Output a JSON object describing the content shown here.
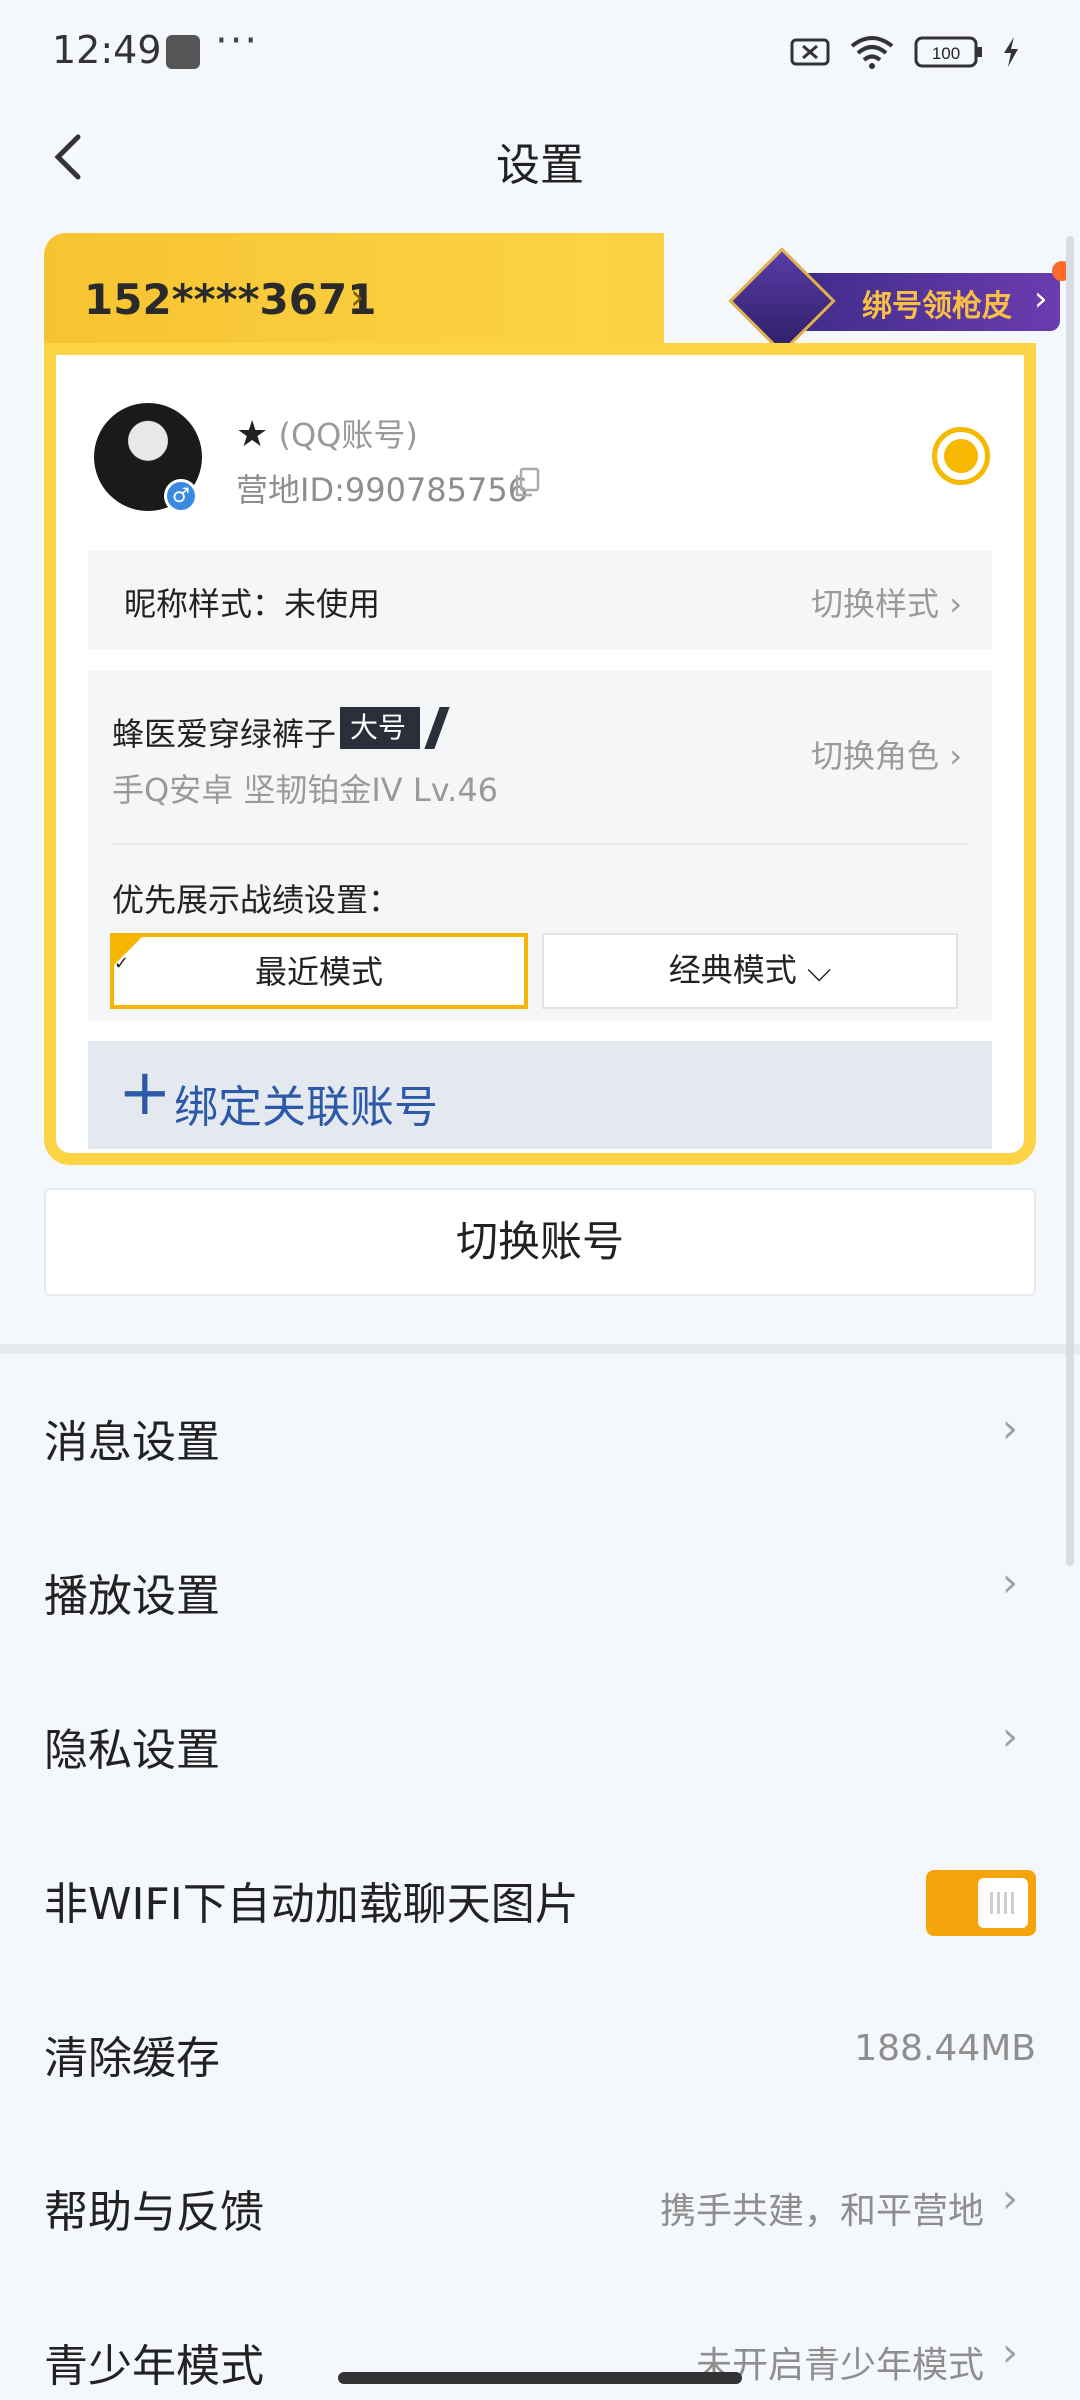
{
  "status_bar": {
    "time": "12:49",
    "dots": "···",
    "battery": "100"
  },
  "header": {
    "title": "设置"
  },
  "account_card": {
    "phone": "152****3671",
    "phone_arrow": "›",
    "promo": {
      "text": "绑号领枪皮",
      "arrow": "›"
    },
    "user": {
      "star": "★",
      "account_type": "(QQ账号)",
      "camp_id": "营地ID:990785756",
      "gender_symbol": "♂"
    },
    "nickname_style": {
      "label": "昵称样式：未使用",
      "action": "切换样式 ›"
    },
    "role": {
      "name": "蜂医爱穿绿裤子",
      "tag": "大号",
      "info": "手Q安卓  坚韧铂金IV  Lv.46",
      "switch": "切换角色 ›"
    },
    "pref_label": "优先展示战绩设置：",
    "modes": {
      "recent": "最近模式",
      "classic": "经典模式 ⌵"
    },
    "bind": {
      "plus": "+",
      "label": "绑定关联账号"
    }
  },
  "switch_account": "切换账号",
  "settings": [
    {
      "label": "消息设置",
      "arrow": "›"
    },
    {
      "label": "播放设置",
      "arrow": "›"
    },
    {
      "label": "隐私设置",
      "arrow": "›"
    },
    {
      "label": "非WIFI下自动加载聊天图片",
      "toggle_on": true
    },
    {
      "label": "清除缓存",
      "value": "188.44MB"
    },
    {
      "label": "帮助与反馈",
      "value": "携手共建，和平营地",
      "arrow": "›"
    },
    {
      "label": "青少年模式",
      "value": "未开启青少年模式",
      "arrow": "›"
    }
  ],
  "colors": {
    "accent": "#f5a40c",
    "card_yellow": "#fbd345",
    "link_blue": "#2d5aa8"
  }
}
